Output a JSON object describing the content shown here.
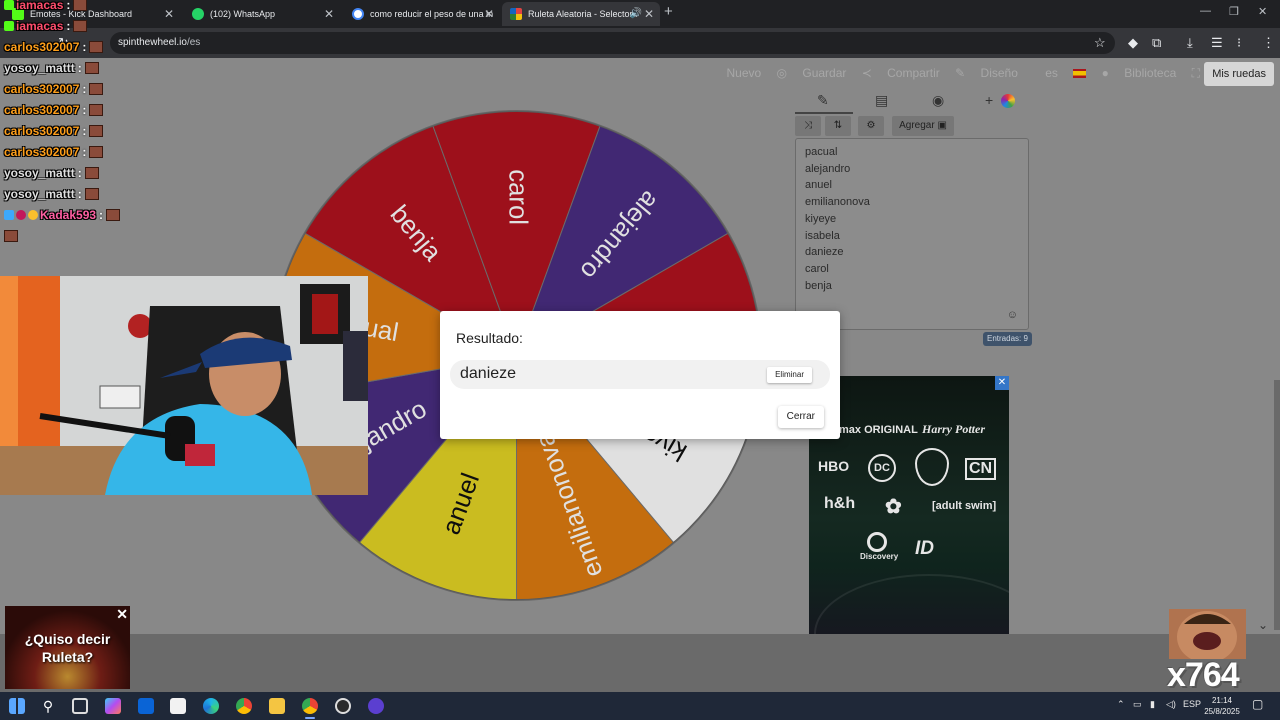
{
  "browser": {
    "tabs": [
      {
        "title": "Emotes - Kick Dashboard",
        "color": "#53fc18",
        "active": false
      },
      {
        "title": "(102) WhatsApp",
        "color": "#25d366",
        "active": false
      },
      {
        "title": "como reducir el peso de una in",
        "color": "#ffffff",
        "active": false
      },
      {
        "title": "Ruleta Aleatoria - Selector I",
        "color": "#e14343",
        "active": true
      }
    ],
    "url_host": "spinthewheel.io",
    "url_path": "/es"
  },
  "site_nav": {
    "nuevo": "Nuevo",
    "guardar": "Guardar",
    "compartir": "Compartir",
    "diseno": "Diseño",
    "lang": "es",
    "biblioteca": "Biblioteca",
    "mis_ruedas": "Mis ruedas"
  },
  "wheel": {
    "segments": [
      {
        "label": "benja",
        "color": "#b3131f"
      },
      {
        "label": "carol",
        "color": "#b3131f"
      },
      {
        "label": "alejandro",
        "color": "#4b2e83"
      },
      {
        "label": "isabela",
        "color": "#b3131f"
      },
      {
        "label": "kiyeye",
        "color": "#ffffff"
      },
      {
        "label": "emilianonova",
        "color": "#e07d10"
      },
      {
        "label": "anuel",
        "color": "#e6d625"
      },
      {
        "label": "alejandro",
        "color": "#4b2e83"
      },
      {
        "label": "pacual",
        "color": "#e07d10"
      }
    ]
  },
  "editor": {
    "agregar_label": "Agregar",
    "entries": [
      "pacual",
      "alejandro",
      "anuel",
      "emilianonova",
      "kiyeye",
      "isabela",
      "danieze",
      "carol",
      "benja"
    ],
    "count_label": "Entradas: 9"
  },
  "modal": {
    "title": "Resultado:",
    "result": "danieze",
    "remove_label": "Eliminar",
    "close_label": "Cerrar"
  },
  "chat": [
    {
      "user": "iamacas",
      "color": "#ff4d6d"
    },
    {
      "user": "carlos302007",
      "color": "#ff9f1a"
    },
    {
      "user": "iamacas",
      "color": "#ff4d6d"
    },
    {
      "user": "yosoy_mattt",
      "color": "#e0e0e0"
    },
    {
      "user": "carlos302007",
      "color": "#ff9f1a"
    },
    {
      "user": "carlos302007",
      "color": "#ff9f1a"
    },
    {
      "user": "carlos302007",
      "color": "#ff9f1a"
    },
    {
      "user": "carlos302007",
      "color": "#ff9f1a"
    },
    {
      "user": "yosoy_mattt",
      "color": "#e0e0e0"
    },
    {
      "user": "yosoy_mattt",
      "color": "#e0e0e0"
    },
    {
      "user": "Kadak593",
      "color": "#ff5fa2"
    }
  ],
  "promo": {
    "text": "¿Quiso decir Ruleta?"
  },
  "ad": {
    "logos": [
      "max ORIGINAL",
      "Harry Potter",
      "HBO",
      "DC",
      "CN",
      "h&h",
      "[adult swim]",
      "Discovery",
      "ID"
    ]
  },
  "stream_counter": "x764",
  "taskbar": {
    "lang": "ESP",
    "time": "21:14",
    "date": "25/8/2025"
  }
}
